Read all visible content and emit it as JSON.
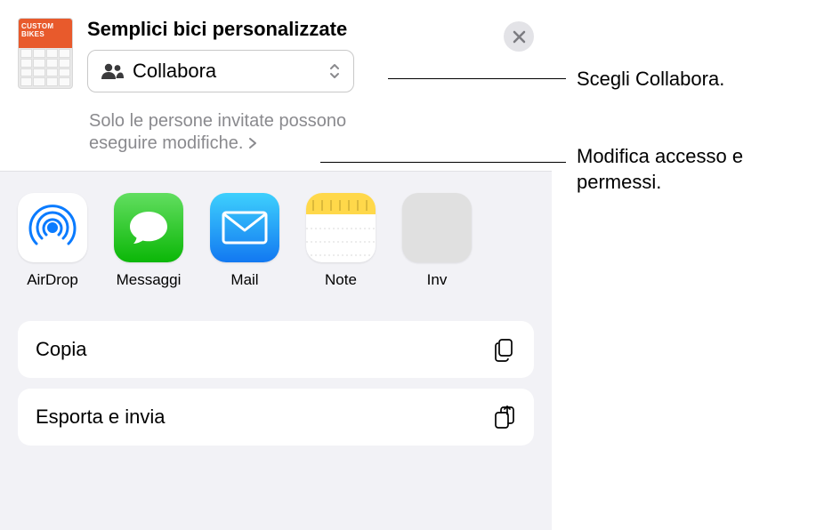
{
  "header": {
    "title": "Semplici bici personalizzate",
    "thumb_label": "CUSTOM BIKES"
  },
  "dropdown": {
    "label": "Collabora"
  },
  "permissions": {
    "text": "Solo le persone invitate possono eseguire modifiche."
  },
  "share": {
    "items": [
      {
        "label": "AirDrop"
      },
      {
        "label": "Messaggi"
      },
      {
        "label": "Mail"
      },
      {
        "label": "Note"
      },
      {
        "label": "Inv"
      }
    ]
  },
  "actions": {
    "copy": "Copia",
    "export": "Esporta e invia"
  },
  "callouts": {
    "choose": "Scegli Collabora.",
    "modify": "Modifica accesso e permessi."
  }
}
